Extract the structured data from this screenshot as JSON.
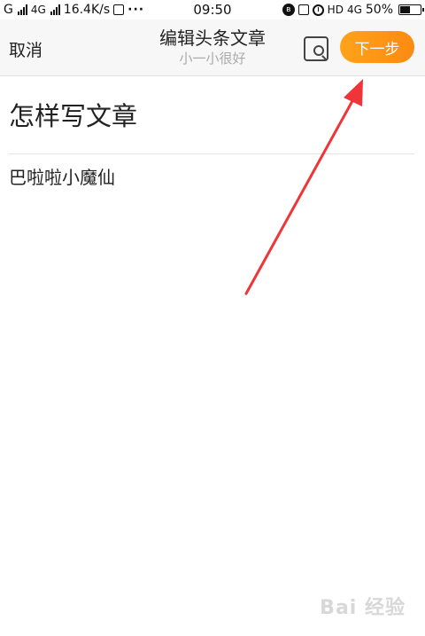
{
  "status_bar": {
    "network1": "G",
    "network2": "4G",
    "speed": "16.4K/s",
    "more": "···",
    "time": "09:50",
    "hd": "HD",
    "net_right": "4G",
    "battery_text": "50%",
    "battery_level": 0.5
  },
  "toolbar": {
    "cancel_label": "取消",
    "title": "编辑头条文章",
    "subtitle": "小一小很好",
    "preview_icon": "preview-search-icon",
    "next_label": "下一步"
  },
  "article": {
    "title": "怎样写文章",
    "body": "巴啦啦小魔仙"
  },
  "annotation": {
    "arrow_color": "#f0353a"
  },
  "watermark": "Bai 经验",
  "colors": {
    "accent": "#fb8a12",
    "toolbar_bg": "#f7f7f7"
  }
}
